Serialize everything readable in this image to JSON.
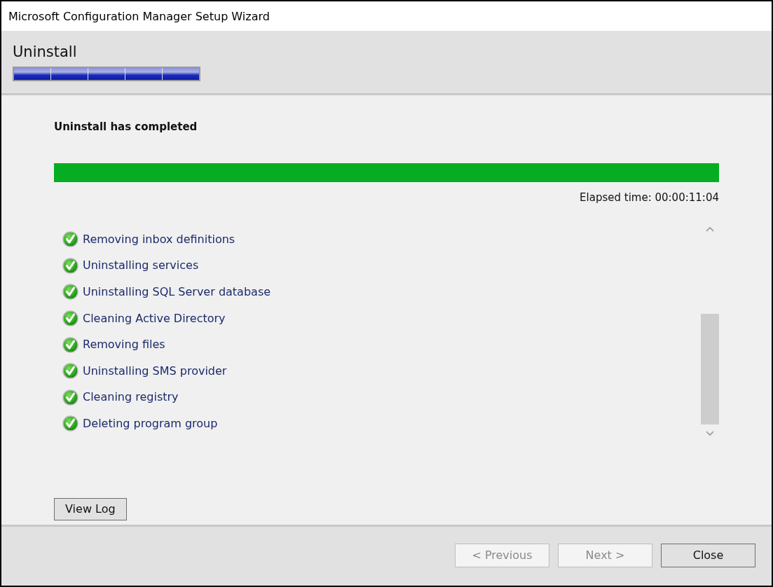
{
  "window": {
    "title": "Microsoft Configuration Manager Setup Wizard"
  },
  "header": {
    "title": "Uninstall",
    "steps": [
      {
        "done": true
      },
      {
        "done": true
      },
      {
        "done": true
      },
      {
        "done": true
      },
      {
        "done": true
      }
    ]
  },
  "status": {
    "message": "Uninstall has completed",
    "level": 1,
    "elapsed": "Elapsed time: 00:00:11:04"
  },
  "tasks": [
    {
      "label": "Removing inbox definitions",
      "completed": true
    },
    {
      "label": "Uninstalling services",
      "completed": true
    },
    {
      "label": "Uninstalling SQL Server database",
      "completed": true
    },
    {
      "label": "Cleaning Active Directory",
      "completed": true
    },
    {
      "label": "Removing files",
      "completed": true
    },
    {
      "label": "Uninstalling SMS provider",
      "completed": true
    },
    {
      "label": "Cleaning registry",
      "completed": true
    },
    {
      "label": "Deleting program group",
      "completed": true
    }
  ],
  "view_log_button": "View Log",
  "buttons": [
    {
      "label": "< Previous",
      "disabled": true
    },
    {
      "label": "Next >",
      "disabled": true
    },
    {
      "label": "Close",
      "disabled": false
    }
  ]
}
